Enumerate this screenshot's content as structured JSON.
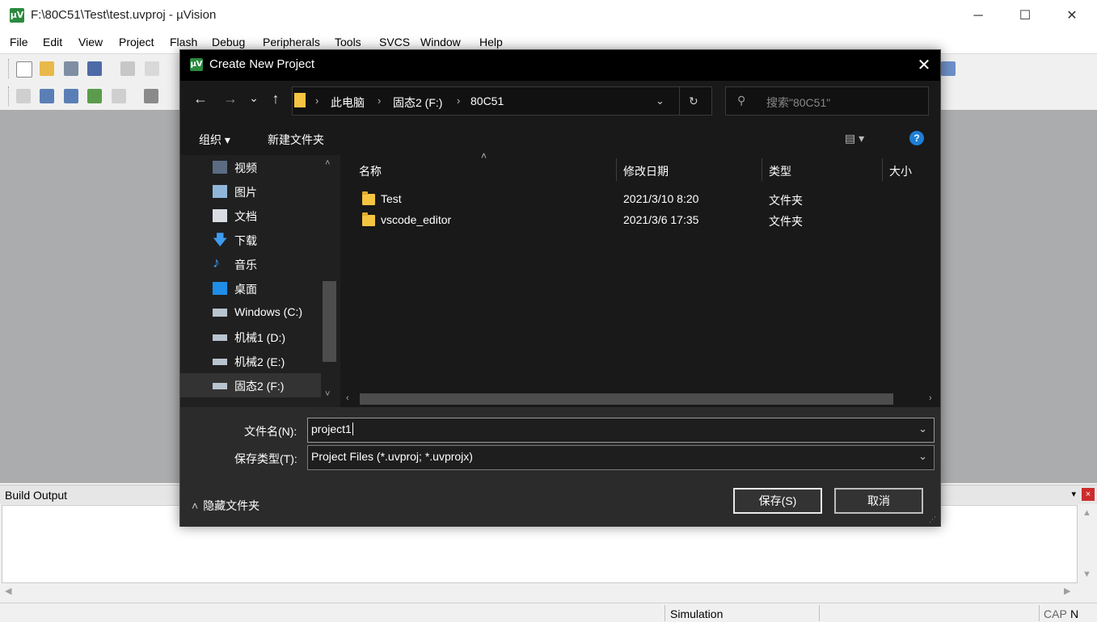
{
  "window": {
    "title": "F:\\80C51\\Test\\test.uvproj - µVision",
    "icon": "µV",
    "controls": {
      "minimize": "─",
      "maximize": "☐",
      "close": "✕"
    }
  },
  "menubar": [
    "File",
    "Edit",
    "View",
    "Project",
    "Flash",
    "Debug",
    "Peripherals",
    "Tools",
    "SVCS",
    "Window",
    "Help"
  ],
  "build_output": {
    "title": "Build Output",
    "pin": "📌",
    "close": "×"
  },
  "statusbar": {
    "mode": "Simulation",
    "cap": "CAP",
    "num": "N"
  },
  "dialog": {
    "title": "Create New Project",
    "close": "✕",
    "nav": {
      "back": "←",
      "forward": "→",
      "recent": "⌄",
      "up": "↑",
      "refresh": "↻",
      "dropdown": "⌄"
    },
    "breadcrumb": [
      "此电脑",
      "固态2 (F:)",
      "80C51"
    ],
    "search_placeholder": "搜索\"80C51\"",
    "commands": {
      "organize": "组织 ▾",
      "new_folder": "新建文件夹"
    },
    "tree": [
      {
        "label": "视频",
        "icon": "video-icon"
      },
      {
        "label": "图片",
        "icon": "pictures-icon"
      },
      {
        "label": "文档",
        "icon": "documents-icon"
      },
      {
        "label": "下载",
        "icon": "downloads-icon"
      },
      {
        "label": "音乐",
        "icon": "music-icon"
      },
      {
        "label": "桌面",
        "icon": "desktop-icon"
      },
      {
        "label": "Windows (C:)",
        "icon": "windows-drive-icon"
      },
      {
        "label": "机械1 (D:)",
        "icon": "drive-icon"
      },
      {
        "label": "机械2 (E:)",
        "icon": "drive-icon"
      },
      {
        "label": "固态2 (F:)",
        "icon": "drive-icon",
        "selected": true
      }
    ],
    "columns": [
      "名称",
      "修改日期",
      "类型",
      "大小"
    ],
    "files": [
      {
        "name": "Test",
        "date": "2021/3/10 8:20",
        "type": "文件夹",
        "size": ""
      },
      {
        "name": "vscode_editor",
        "date": "2021/3/6 17:35",
        "type": "文件夹",
        "size": ""
      }
    ],
    "filename_label": "文件名(N):",
    "filename_value": "project1",
    "filetype_label": "保存类型(T):",
    "filetype_value": "Project Files (*.uvproj; *.uvprojx)",
    "hide_folders": "隐藏文件夹",
    "save_button": "保存(S)",
    "cancel_button": "取消"
  }
}
